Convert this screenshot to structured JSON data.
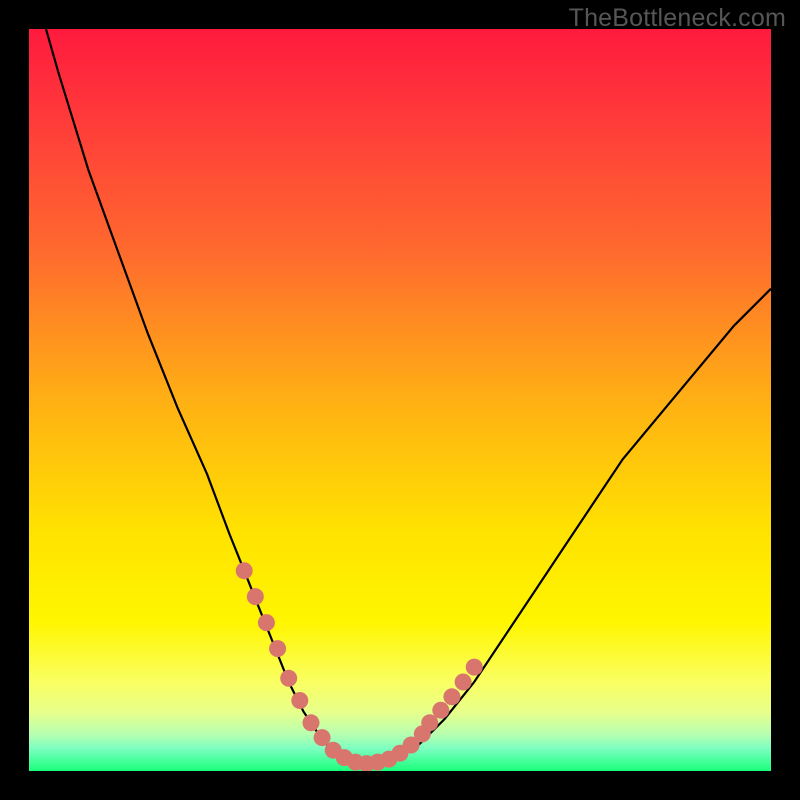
{
  "watermark": "TheBottleneck.com",
  "colors": {
    "frame": "#000000",
    "gradient_stops": [
      {
        "pct": 0,
        "color": "#ff1a3e"
      },
      {
        "pct": 12,
        "color": "#ff3a3a"
      },
      {
        "pct": 30,
        "color": "#ff6a2e"
      },
      {
        "pct": 50,
        "color": "#ffb014"
      },
      {
        "pct": 68,
        "color": "#ffe300"
      },
      {
        "pct": 80,
        "color": "#fff600"
      },
      {
        "pct": 88,
        "color": "#faff62"
      },
      {
        "pct": 92,
        "color": "#e8ff8a"
      },
      {
        "pct": 95,
        "color": "#b8ffb0"
      },
      {
        "pct": 97,
        "color": "#7bffc0"
      },
      {
        "pct": 100,
        "color": "#1aff7a"
      }
    ],
    "curve_stroke": "#000000",
    "marker_fill": "#d8766e"
  },
  "chart_data": {
    "type": "line",
    "title": "",
    "xlabel": "",
    "ylabel": "",
    "xlim": [
      0,
      100
    ],
    "ylim": [
      0,
      100
    ],
    "grid": false,
    "series": [
      {
        "name": "bottleneck-curve",
        "x": [
          0,
          4,
          8,
          12,
          16,
          20,
          24,
          27,
          29,
          31,
          33,
          35,
          37,
          39,
          41,
          43,
          45,
          48,
          52,
          56,
          60,
          64,
          68,
          72,
          76,
          80,
          85,
          90,
          95,
          100
        ],
        "y": [
          108,
          94,
          81,
          70,
          59,
          49,
          40,
          32,
          27,
          22,
          17,
          12,
          8,
          5,
          2.5,
          1.2,
          1,
          1.3,
          3,
          7,
          12,
          18,
          24,
          30,
          36,
          42,
          48,
          54,
          60,
          65
        ]
      }
    ],
    "markers": {
      "name": "highlight-points",
      "x": [
        29,
        30.5,
        32,
        33.5,
        35,
        36.5,
        38,
        39.5,
        41,
        42.5,
        44,
        45.5,
        47,
        48.5,
        50,
        51.5,
        53,
        54,
        55.5,
        57,
        58.5,
        60
      ],
      "y": [
        27,
        23.5,
        20,
        16.5,
        12.5,
        9.5,
        6.5,
        4.5,
        2.8,
        1.8,
        1.2,
        1,
        1.2,
        1.6,
        2.4,
        3.5,
        5,
        6.5,
        8.2,
        10,
        12,
        14
      ]
    }
  }
}
